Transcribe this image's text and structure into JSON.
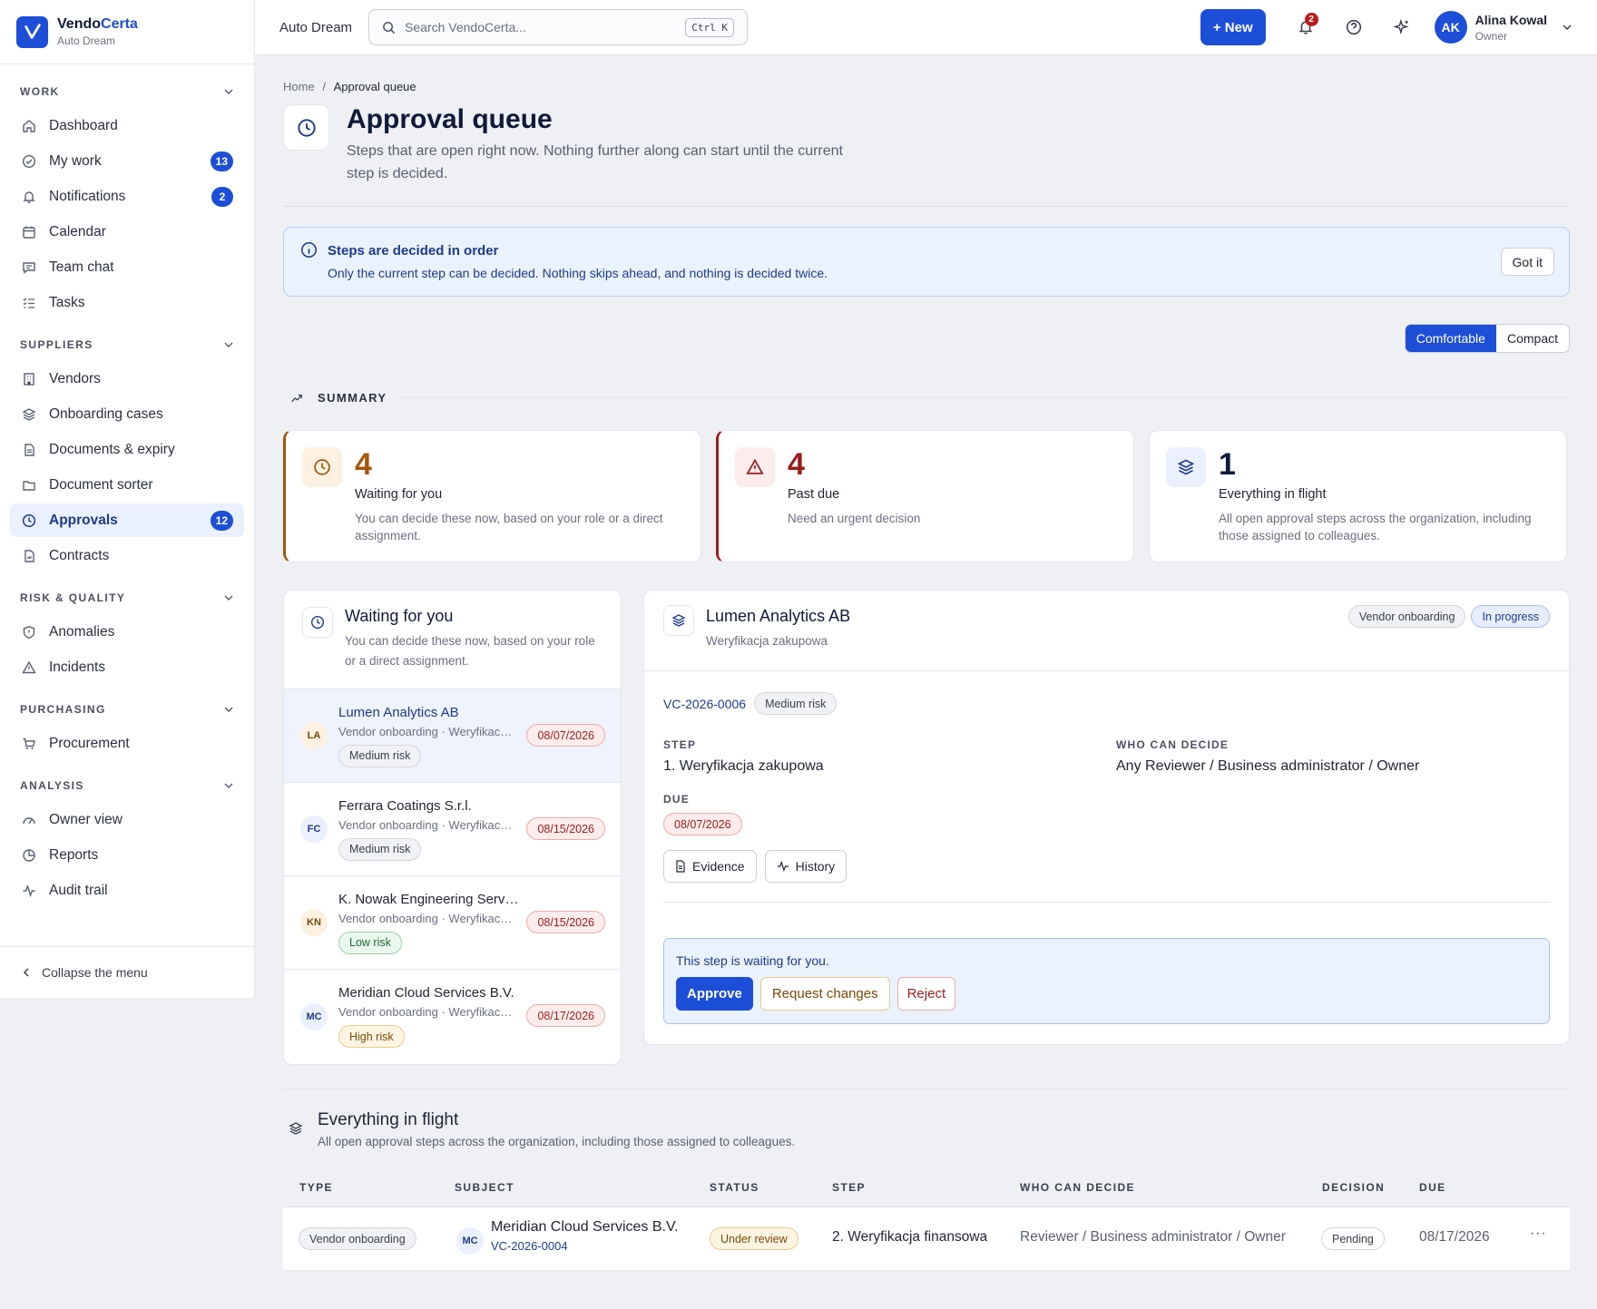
{
  "brand": {
    "name_main": "Vendo",
    "name_accent": "Certa",
    "org": "Auto Dream"
  },
  "sidebar": {
    "groups": [
      {
        "title": "WORK",
        "items": [
          {
            "label": "Dashboard"
          },
          {
            "label": "My work",
            "badge": "13"
          },
          {
            "label": "Notifications",
            "badge": "2"
          },
          {
            "label": "Calendar"
          },
          {
            "label": "Team chat"
          },
          {
            "label": "Tasks"
          }
        ]
      },
      {
        "title": "SUPPLIERS",
        "items": [
          {
            "label": "Vendors"
          },
          {
            "label": "Onboarding cases"
          },
          {
            "label": "Documents & expiry"
          },
          {
            "label": "Document sorter"
          },
          {
            "label": "Approvals",
            "badge": "12"
          },
          {
            "label": "Contracts"
          }
        ]
      },
      {
        "title": "RISK & QUALITY",
        "items": [
          {
            "label": "Anomalies"
          },
          {
            "label": "Incidents"
          }
        ]
      },
      {
        "title": "PURCHASING",
        "items": [
          {
            "label": "Procurement"
          }
        ]
      },
      {
        "title": "ANALYSIS",
        "items": [
          {
            "label": "Owner view"
          },
          {
            "label": "Reports"
          },
          {
            "label": "Audit trail"
          }
        ]
      }
    ],
    "collapse_label": "Collapse the menu"
  },
  "topbar": {
    "org": "Auto Dream",
    "search_placeholder": "Search VendoCerta...",
    "search_shortcut": "Ctrl K",
    "new_label": "+ New",
    "notif_count": "2",
    "user_initials": "AK",
    "user_name": "Alina Kowal",
    "user_role": "Owner"
  },
  "page": {
    "crumb_home": "Home",
    "crumb_sep": "/",
    "crumb_current": "Approval queue",
    "title": "Approval queue",
    "subtitle": "Steps that are open right now. Nothing further along can start until the current step is decided."
  },
  "info": {
    "title": "Steps are decided in order",
    "body": "Only the current step can be decided. Nothing skips ahead, and nothing is decided twice.",
    "dismiss": "Got it"
  },
  "density": {
    "comfortable": "Comfortable",
    "compact": "Compact"
  },
  "summary": {
    "heading": "SUMMARY",
    "cards": [
      {
        "num": "4",
        "title": "Waiting for you",
        "desc": "You can decide these now, based on your role or a direct assignment.",
        "color": "#a6570a"
      },
      {
        "num": "4",
        "title": "Past due",
        "desc": "Need an urgent decision",
        "color": "#9b1c1c"
      },
      {
        "num": "1",
        "title": "Everything in flight",
        "desc": "All open approval steps across the organization, including those assigned to colleagues.",
        "color": "#0f1a3a"
      }
    ]
  },
  "queue": {
    "title": "Waiting for you",
    "subtitle": "You can decide these now, based on your role or a direct assignment.",
    "rows": [
      {
        "initials": "LA",
        "name": "Lumen Analytics AB",
        "meta": "Vendor onboarding · Weryfikacja zakupowa",
        "risk": "Medium risk",
        "due": "08/07/2026"
      },
      {
        "initials": "FC",
        "name": "Ferrara Coatings S.r.l.",
        "meta": "Vendor onboarding · Weryfikacja zakupowa",
        "risk": "Medium risk",
        "due": "08/15/2026"
      },
      {
        "initials": "KN",
        "name": "K. Nowak Engineering Services",
        "meta": "Vendor onboarding · Weryfikacja zakupowa",
        "risk": "Low risk",
        "due": "08/15/2026"
      },
      {
        "initials": "MC",
        "name": "Meridian Cloud Services B.V.",
        "meta": "Vendor onboarding · Weryfikacja zakupowa",
        "risk": "High risk",
        "due": "08/17/2026"
      }
    ]
  },
  "detail": {
    "name": "Lumen Analytics AB",
    "sub": "Weryfikacja zakupowa",
    "type_pill": "Vendor onboarding",
    "status_pill": "In progress",
    "ref": "VC-2026-0006",
    "risk": "Medium risk",
    "step_label": "STEP",
    "step_value": "1. Weryfikacja zakupowa",
    "who_label": "WHO CAN DECIDE",
    "who_value": "Any Reviewer / Business administrator / Owner",
    "due_label": "DUE",
    "due_value": "08/07/2026",
    "evidence": "Evidence",
    "history": "History",
    "waiting_msg": "This step is waiting for you.",
    "approve": "Approve",
    "request_changes": "Request changes",
    "reject": "Reject"
  },
  "flight": {
    "title": "Everything in flight",
    "subtitle": "All open approval steps across the organization, including those assigned to colleagues.",
    "columns": [
      "TYPE",
      "SUBJECT",
      "STATUS",
      "STEP",
      "WHO CAN DECIDE",
      "DECISION",
      "DUE"
    ],
    "rows": [
      {
        "type": "Vendor onboarding",
        "initials": "MC",
        "subject": "Meridian Cloud Services B.V.",
        "ref": "VC-2026-0004",
        "status": "Under review",
        "step": "2. Weryfikacja finansowa",
        "who": "Reviewer / Business administrator / Owner",
        "decision": "Pending",
        "due": "08/17/2026",
        "more": "···"
      }
    ]
  }
}
